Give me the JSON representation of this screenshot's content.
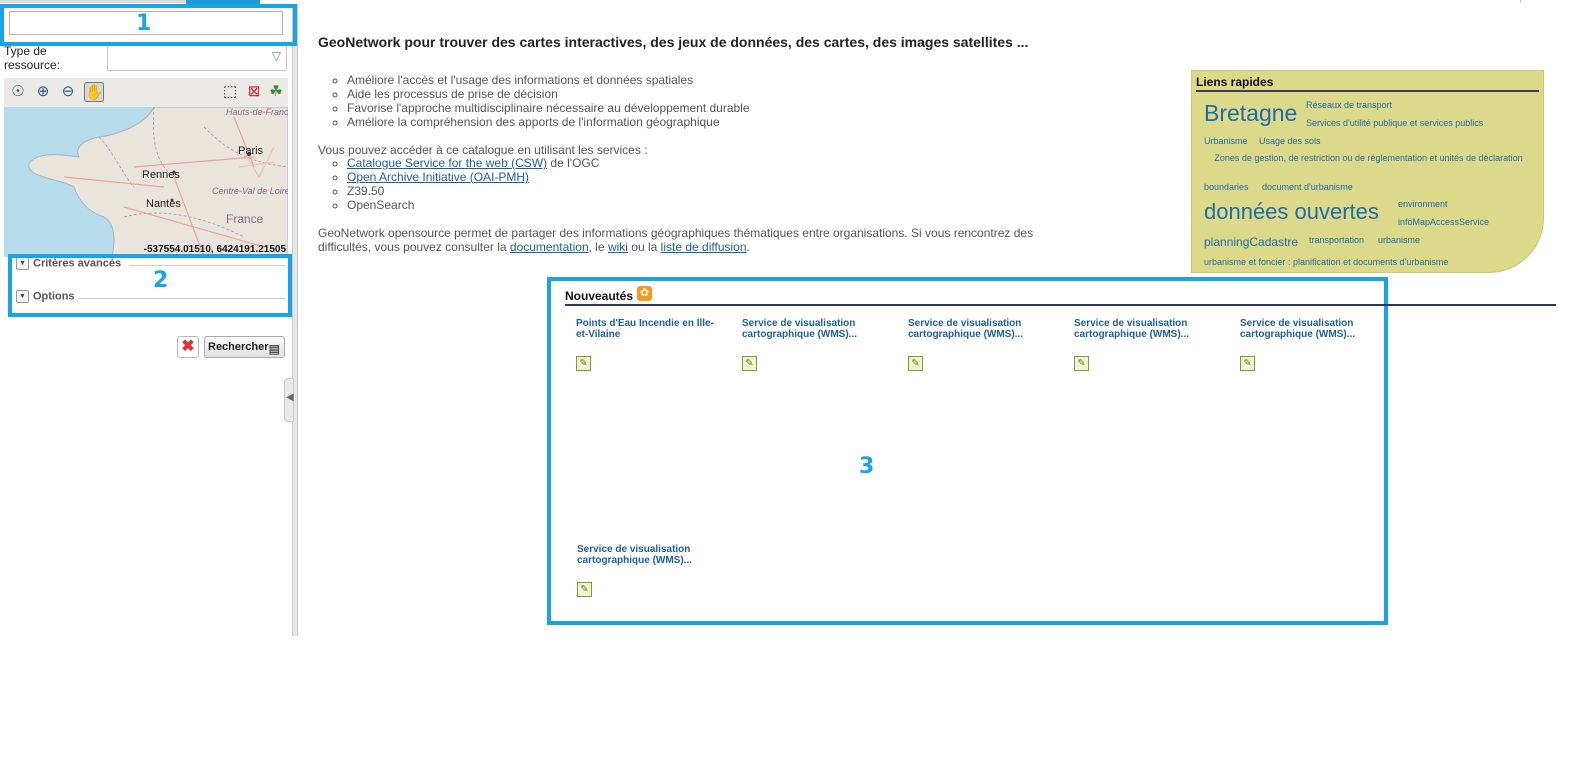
{
  "search": {
    "value": "",
    "placeholder": ""
  },
  "resource_type": {
    "label": "Type de ressource:",
    "selected": ""
  },
  "map": {
    "labels": [
      "Hauts-de-France",
      "Paris",
      "Rennes",
      "Nantes",
      "Centre-Val de Loire",
      "France"
    ],
    "coordinates": "-537554.01510, 6424191.21505"
  },
  "advanced": {
    "criteria_label": "Critères avancés",
    "options_label": "Options"
  },
  "search_button": {
    "label": "Rechercher"
  },
  "annotations": {
    "one": "1",
    "two": "2",
    "three": "3"
  },
  "main": {
    "title": "GeoNetwork pour trouver des cartes interactives, des jeux de données, des cartes, des images satellites ...",
    "features": [
      "Améliore l'accès et l'usage des informations et données spatiales",
      "Aide les processus de prise de décision",
      "Favorise l'approche multidisciplinaire nécessaire au développement durable",
      "Améliore la compréhension des apports de l'information géographique"
    ],
    "services_intro": "Vous pouvez accéder à ce catalogue en utilisant les services :",
    "services": [
      {
        "link": "Catalogue Service for the web (CSW)",
        "suffix": " de l'OGC"
      },
      {
        "link": "Open Archive Initiative (OAI-PMH)",
        "suffix": ""
      },
      {
        "link": "",
        "suffix": "Z39.50"
      },
      {
        "link": "",
        "suffix": "OpenSearch"
      }
    ],
    "description": {
      "text1": "GeoNetwork opensource permet de partager des informations géographiques thématiques entre organisations. Si vous rencontrez des difficultés, vous pouvez consulter la ",
      "link1": "documentation",
      "text2": ", le ",
      "link2": "wiki",
      "text3": " ou la ",
      "link3": "liste de diffusion",
      "text4": "."
    }
  },
  "quick_links": {
    "title": "Liens rapides",
    "tags": [
      "Bretagne",
      "Réseaux de transport",
      "Services d'utilité publique et services publics",
      "Urbanisme",
      "Usage des sols",
      "Zones de gestion, de restriction ou de réglementation et unités de déclaration",
      "boundaries",
      "document d'urbanisme",
      "données ouvertes",
      "environment",
      "infoMapAccessService",
      "planningCadastre",
      "transportation",
      "urbanisme",
      "urbanisme et foncier : planification et documents d'urbanisme"
    ]
  },
  "news": {
    "title": "Nouveautés",
    "items": [
      "Points d'Eau Incendie en Ille-et-Vilaine",
      "Service de visualisation cartographique (WMS)...",
      "Service de visualisation cartographique (WMS)...",
      "Service de visualisation cartographique (WMS)...",
      "Service de visualisation cartographique (WMS)...",
      "Service de visualisation cartographique (WMS)..."
    ]
  }
}
